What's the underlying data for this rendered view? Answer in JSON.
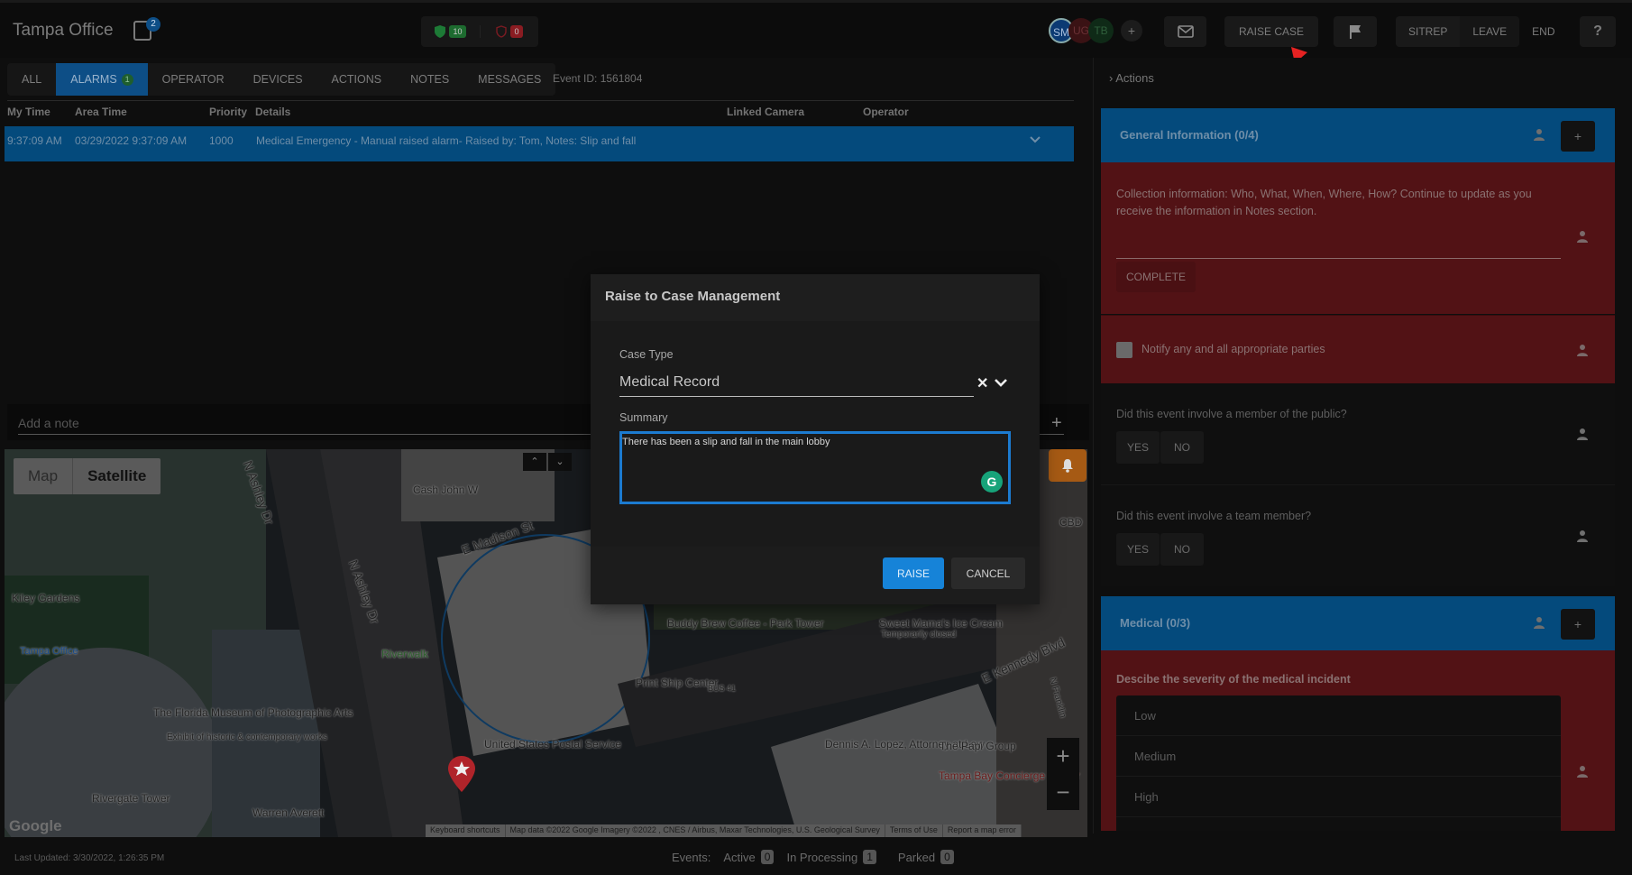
{
  "header": {
    "title": "Tampa Office",
    "notes_count": "2",
    "shield_ok_count": "10",
    "shield_alert_count": "0",
    "avatars": [
      {
        "initials": "SM",
        "color": "#0b3a73"
      },
      {
        "initials": "UG",
        "color": "#3a1214"
      },
      {
        "initials": "TB",
        "color": "#0f2a17"
      }
    ],
    "add_participant": "+",
    "raise_case_label": "RAISE CASE",
    "sitrep_label": "SITREP",
    "leave_label": "LEAVE",
    "end_label": "END",
    "help_label": "?"
  },
  "tabs": [
    {
      "label": "ALL"
    },
    {
      "label": "ALARMS",
      "badge": "1",
      "active": true
    },
    {
      "label": "OPERATOR"
    },
    {
      "label": "DEVICES"
    },
    {
      "label": "ACTIONS"
    },
    {
      "label": "NOTES"
    },
    {
      "label": "MESSAGES"
    }
  ],
  "event_id": "Event ID: 1561804",
  "table": {
    "columns": [
      "My Time",
      "Area Time",
      "Priority",
      "Details",
      "Linked Camera",
      "Operator"
    ],
    "rows": [
      {
        "my_time": "9:37:09 AM",
        "area_time": "03/29/2022 9:37:09 AM",
        "priority": "1000",
        "details": "Medical Emergency - Manual raised alarm- Raised by: Tom, Notes: Slip and fall",
        "linked_camera": "",
        "operator": ""
      }
    ]
  },
  "note": {
    "placeholder": "Add a note",
    "value": ""
  },
  "map": {
    "type_options": [
      "Map",
      "Satellite"
    ],
    "selected_type": "Satellite",
    "labels": [
      "Cash John W",
      "E Madison St",
      "N Ashley Dr",
      "N Ashley Dr",
      "Kiley Gardens",
      "Tampa Office",
      "Riverwalk",
      "The Florida Museum of Photographic Arts",
      "Exhibit of historic & contemporary works",
      "Rivergate Tower",
      "Warren Averett",
      "United States Postal Service",
      "Buddy Brew Coffee - Park Tower",
      "Print Ship Center",
      "Sweet Mama's Ice Cream",
      "Temporarily closed",
      "E Kennedy Blvd",
      "Dennis A. Lopez, Attorney at Law",
      "The Papi Group",
      "Tampa Bay Concierge Doctor",
      "CBD",
      "N Franklin",
      "BUS 41"
    ],
    "google_logo": "Google",
    "footer": [
      "Keyboard shortcuts",
      "Map data ©2022 Google Imagery ©2022 , CNES / Airbus, Maxar Technologies, U.S. Geological Survey",
      "Terms of Use",
      "Report a map error"
    ],
    "zoom_in": "+",
    "zoom_out": "−"
  },
  "footer": {
    "last_updated": "Last Updated: 3/30/2022, 1:26:35 PM",
    "events_label": "Events:",
    "active_label": "Active",
    "active_count": "0",
    "processing_label": "In Processing",
    "processing_count": "1",
    "parked_label": "Parked",
    "parked_count": "0"
  },
  "right_panel": {
    "actions_label": "Actions",
    "sections": [
      {
        "title": "General Information (0/4)",
        "tasks": [
          {
            "text": "Collection information: Who, What, When, Where, How? Continue to update as you receive the information in Notes section.",
            "button": "COMPLETE"
          },
          {
            "text": "Notify any and all appropriate parties",
            "checked": false
          },
          {
            "text": "Did this event involve a member of the public?",
            "yes": "YES",
            "no": "NO"
          },
          {
            "text": "Did this event involve a team member?",
            "yes": "YES",
            "no": "NO"
          }
        ]
      },
      {
        "title": "Medical (0/3)",
        "tasks": [
          {
            "text": "Descibe the severity of the medical incident",
            "options": [
              "Low",
              "Medium",
              "High"
            ]
          }
        ]
      }
    ]
  },
  "modal": {
    "title": "Raise to Case Management",
    "case_type_label": "Case Type",
    "case_type_value": "Medical Record",
    "summary_label": "Summary",
    "summary_value": "There has been a slip and fall in the main lobby",
    "raise_label": "RAISE",
    "cancel_label": "CANCEL"
  },
  "colors": {
    "accent_blue": "#044a7c",
    "primary_button": "#1683d8",
    "task_red": "#521215",
    "shield_green": "#1d6b2f",
    "shield_red": "#8a1c22",
    "bell_orange": "#a65a14"
  }
}
